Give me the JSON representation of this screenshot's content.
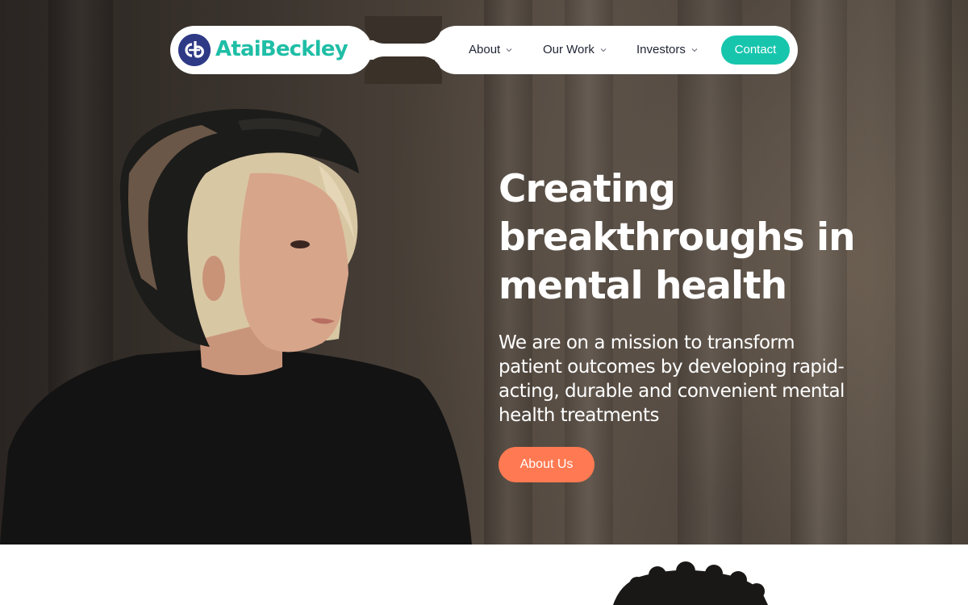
{
  "nav": {
    "logo_text": "AtaiBeckley",
    "logo_icon": "cb-monogram-icon",
    "items": [
      {
        "label": "About",
        "icon": "chevron-down-icon"
      },
      {
        "label": "Our Work",
        "icon": "chevron-down-icon"
      },
      {
        "label": "Investors",
        "icon": "chevron-down-icon"
      }
    ],
    "contact_label": "Contact"
  },
  "hero": {
    "title_lines": [
      "Creating",
      "breakthroughs in",
      "mental health"
    ],
    "subtitle_lines": [
      "We are on a mission to transform",
      "patient outcomes by developing rapid-",
      "acting, durable and convenient mental",
      "health treatments"
    ],
    "cta_label": "About Us",
    "image": "woman-in-beanie-photo"
  },
  "next_section": {
    "image": "person-curly-hair-photo"
  },
  "colors": {
    "brand_teal": "#17c5ad",
    "logo_navy": "#2e3a86",
    "cta_orange": "#ff7a52",
    "nav_text": "#1f2433"
  }
}
